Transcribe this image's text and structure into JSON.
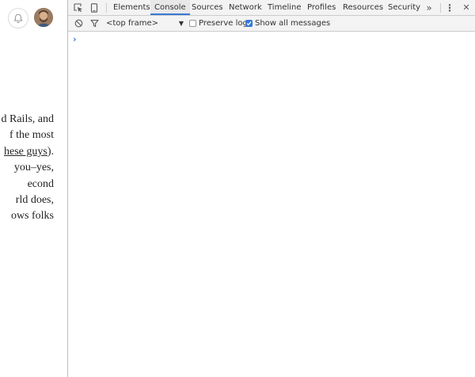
{
  "article": {
    "lines": [
      {
        "text": "d Rails, and"
      },
      {
        "text": "f the most"
      },
      {
        "before": "",
        "link": "hese guys",
        "after": ")."
      },
      {
        "text": "you–yes,"
      },
      {
        "text": "econd"
      },
      {
        "text": "rld does,"
      },
      {
        "text": "ows folks"
      }
    ]
  },
  "header": {
    "bell_icon": "bell-icon",
    "avatar": "user-avatar"
  },
  "devtools": {
    "tabs": [
      {
        "label": "Elements",
        "active": false
      },
      {
        "label": "Console",
        "active": true
      },
      {
        "label": "Sources",
        "active": false
      },
      {
        "label": "Network",
        "active": false
      },
      {
        "label": "Timeline",
        "active": false
      },
      {
        "label": "Profiles",
        "active": false
      },
      {
        "label": "Resources",
        "active": false
      },
      {
        "label": "Security",
        "active": false
      }
    ],
    "more_tabs": "»",
    "menu_icon": "⋮",
    "close_icon": "✕",
    "toolbar": {
      "frame": "<top frame>",
      "preserve_log": {
        "label": "Preserve log",
        "checked": false
      },
      "show_all": {
        "label": "Show all messages",
        "checked": true
      }
    },
    "prompt": "›",
    "accent": "#3879d9"
  }
}
